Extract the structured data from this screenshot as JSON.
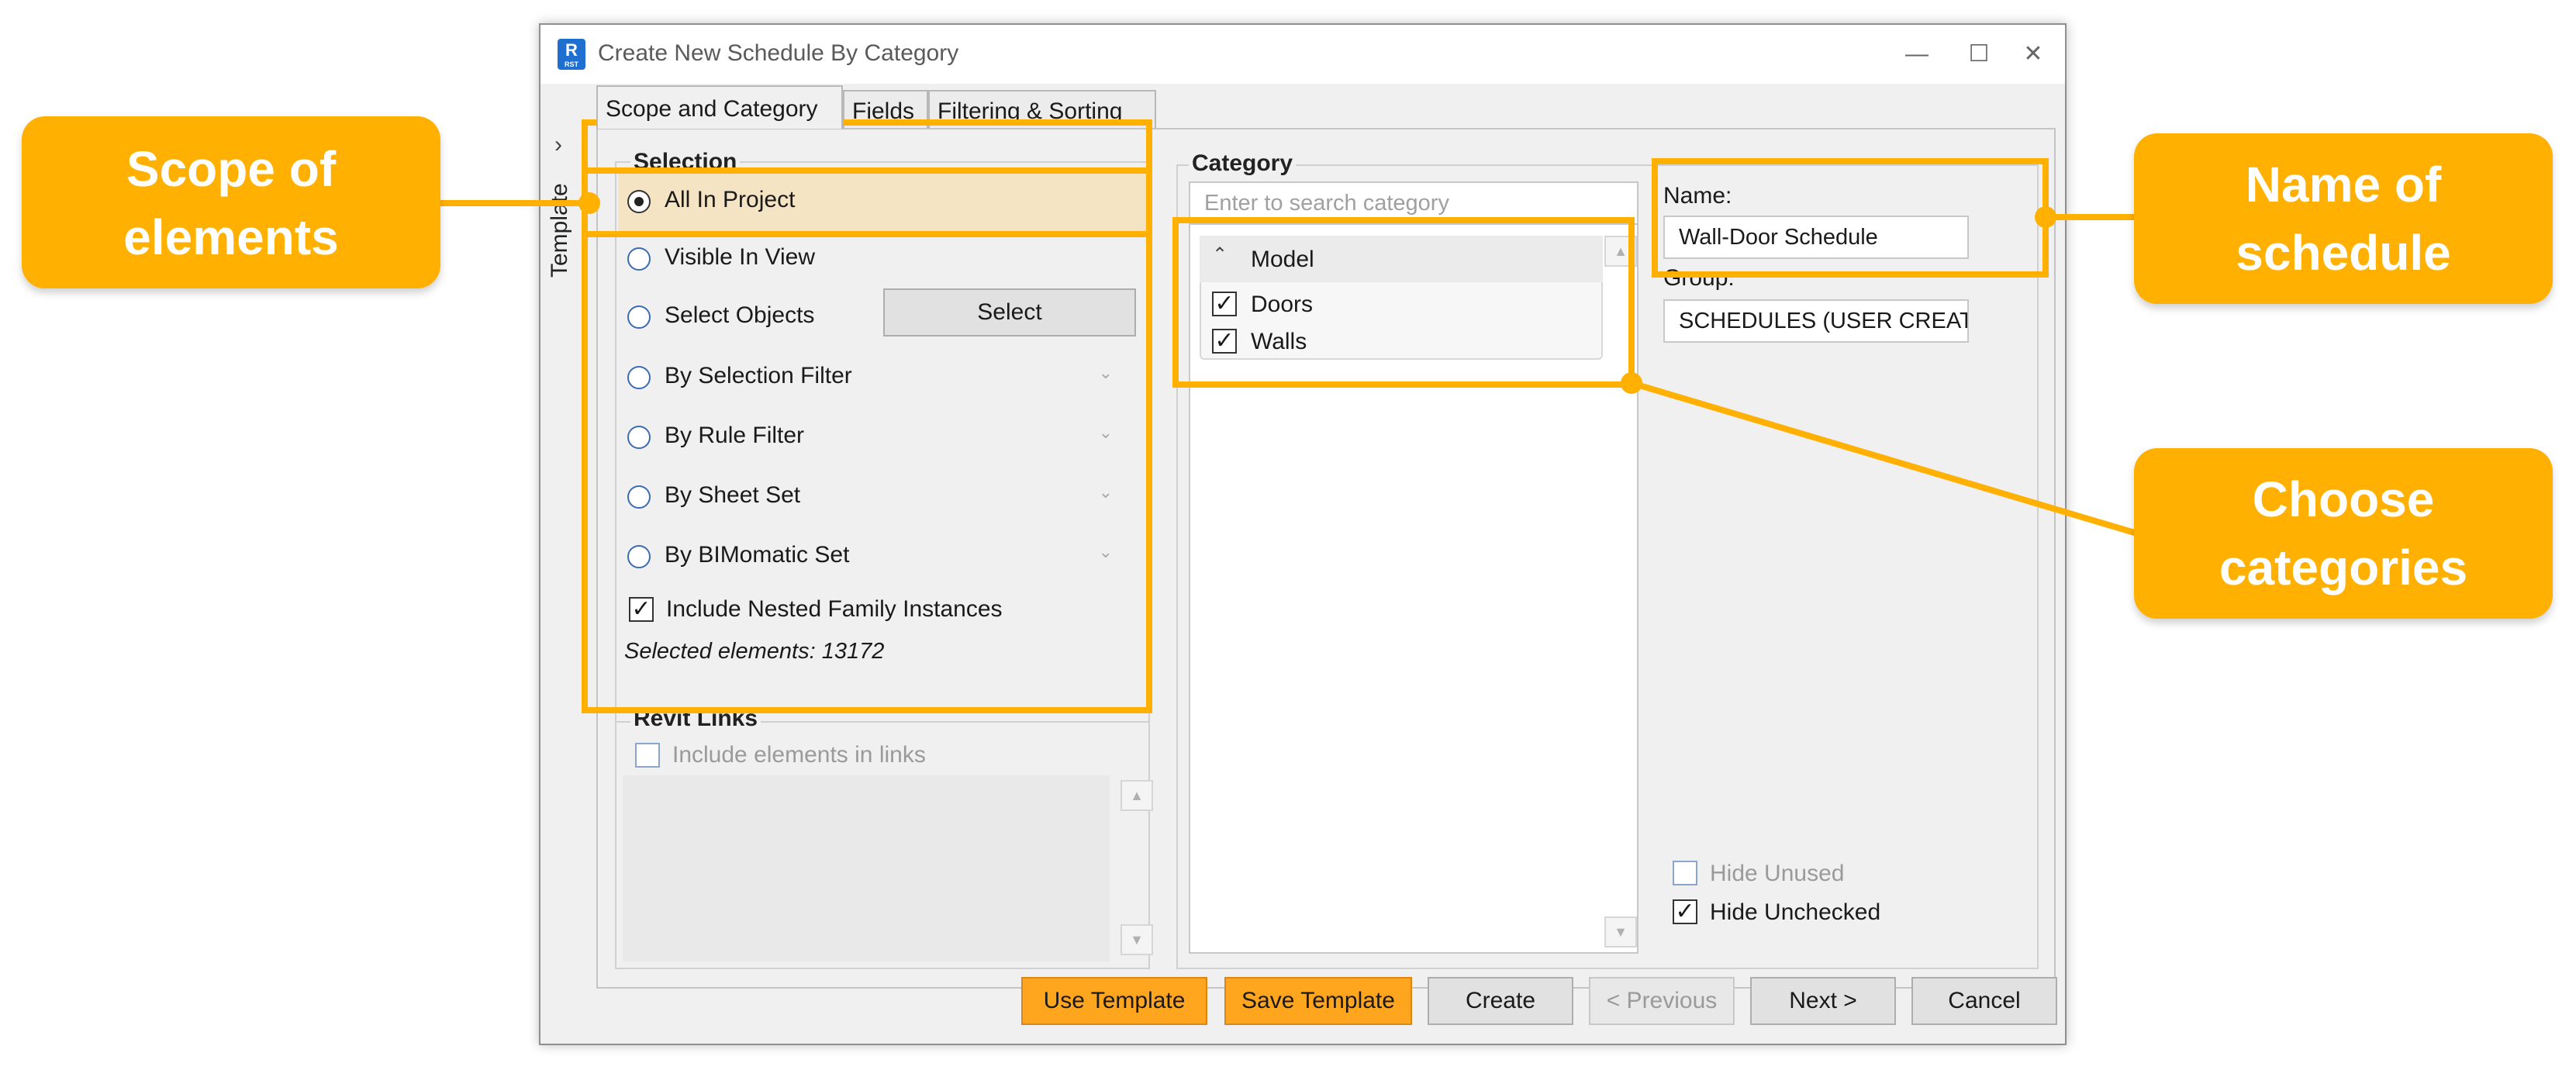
{
  "window": {
    "app_icon_letter": "R",
    "app_icon_sub": "RST",
    "title": "Create New Schedule By Category",
    "minimize_glyph": "—",
    "maximize_glyph": "☐",
    "close_glyph": "✕"
  },
  "template_strip": {
    "chevron": "›",
    "label": "Template"
  },
  "tabs": [
    {
      "label": "Scope and Category"
    },
    {
      "label": "Fields"
    },
    {
      "label": "Filtering & Sorting"
    }
  ],
  "selection": {
    "heading": "Selection",
    "options": [
      {
        "label": "All In Project",
        "selected": true
      },
      {
        "label": "Visible In View"
      },
      {
        "label": "Select Objects"
      },
      {
        "label": "By Selection Filter"
      },
      {
        "label": "By Rule Filter"
      },
      {
        "label": "By Sheet Set"
      },
      {
        "label": "By BIMomatic Set"
      }
    ],
    "select_button": "Select",
    "nested_label": "Include Nested Family Instances",
    "selected_count": "Selected elements: 13172"
  },
  "revit_links": {
    "heading": "Revit Links",
    "include_label": "Include elements in links"
  },
  "category": {
    "heading": "Category",
    "search_placeholder": "Enter to search category",
    "group_name": "Model",
    "items": [
      {
        "label": "Doors",
        "checked": true
      },
      {
        "label": "Walls",
        "checked": true
      }
    ]
  },
  "schedule": {
    "name_label": "Name:",
    "name_value": "Wall-Door Schedule",
    "group_label": "Group:",
    "group_value": "SCHEDULES (USER CREAT",
    "hide_unused": "Hide Unused",
    "hide_unchecked": "Hide Unchecked"
  },
  "footer": {
    "use_template": "Use Template",
    "save_template": "Save Template",
    "create": "Create",
    "previous": "< Previous",
    "next": "Next >",
    "cancel": "Cancel"
  },
  "annotations": {
    "scope": "Scope of elements",
    "name": "Name of schedule",
    "categories": "Choose categories",
    "color": "#ffb000"
  }
}
